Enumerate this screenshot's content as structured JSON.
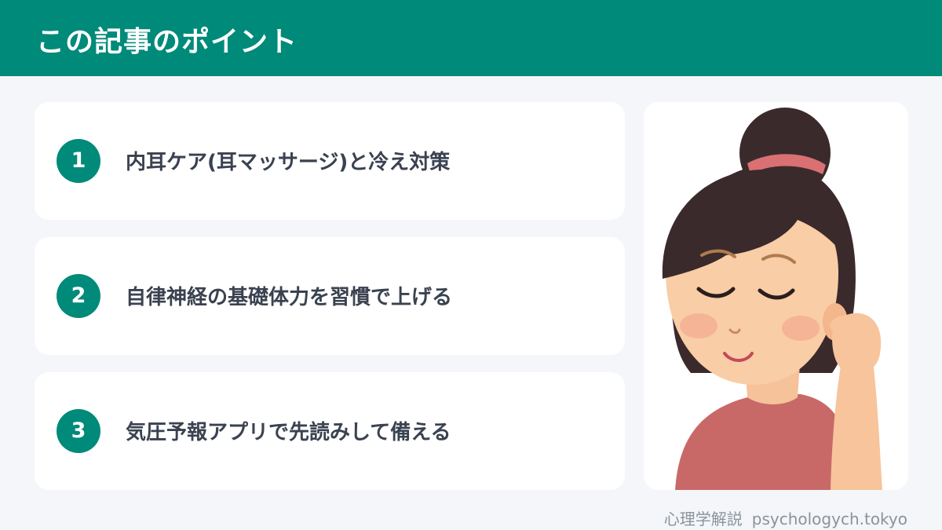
{
  "header": {
    "title": "この記事のポイント"
  },
  "points": [
    {
      "number": "1",
      "text": "内耳ケア(耳マッサージ)と冷え対策"
    },
    {
      "number": "2",
      "text": "自律神経の基礎体力を習慣で上げる"
    },
    {
      "number": "3",
      "text": "気圧予報アプリで先読みして備える"
    }
  ],
  "footer": {
    "site_name": "心理学解説",
    "domain": "psychologych.tokyo"
  },
  "colors": {
    "accent": "#008a7a",
    "text": "#3a4250",
    "background": "#f4f6f9"
  }
}
